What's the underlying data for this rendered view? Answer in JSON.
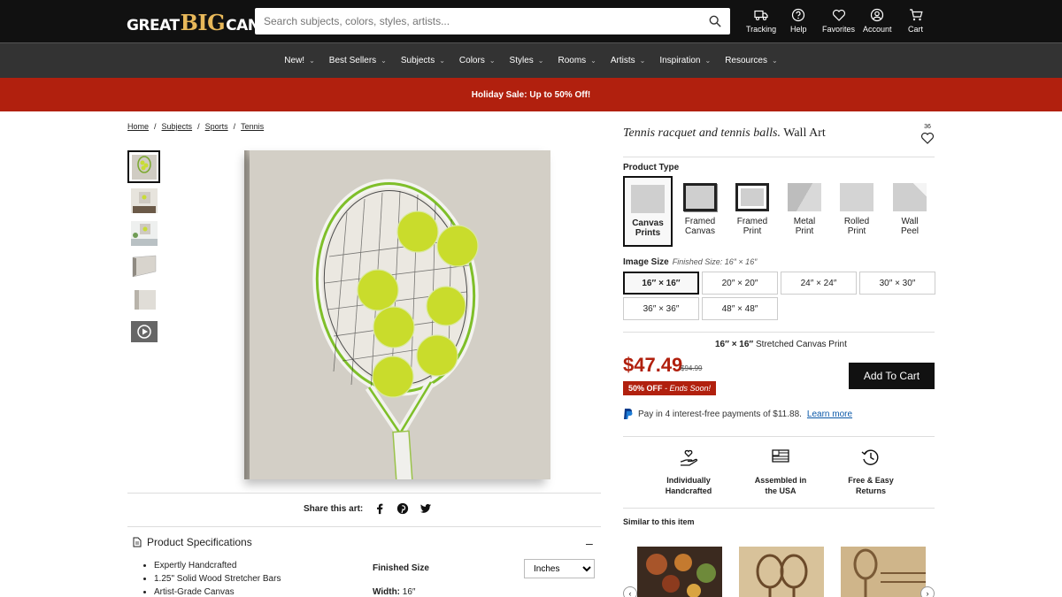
{
  "header": {
    "logo": {
      "part1": "GREAT",
      "part2": "BIG",
      "part3": "CANVAS."
    },
    "search_placeholder": "Search subjects, colors, styles, artists...",
    "nav": [
      {
        "label": "Tracking",
        "icon": "truck-icon"
      },
      {
        "label": "Help",
        "icon": "help-icon"
      },
      {
        "label": "Favorites",
        "icon": "heart-icon"
      },
      {
        "label": "Account",
        "icon": "account-icon"
      },
      {
        "label": "Cart",
        "icon": "cart-icon"
      }
    ]
  },
  "menu": [
    {
      "label": "New!"
    },
    {
      "label": "Best Sellers"
    },
    {
      "label": "Subjects"
    },
    {
      "label": "Colors"
    },
    {
      "label": "Styles"
    },
    {
      "label": "Rooms"
    },
    {
      "label": "Artists"
    },
    {
      "label": "Inspiration"
    },
    {
      "label": "Resources"
    }
  ],
  "promo": "Holiday Sale: Up to 50% Off!",
  "breadcrumb": [
    "Home",
    "Subjects",
    "Sports",
    "Tennis"
  ],
  "product": {
    "title_italic": "Tennis racquet and tennis balls.",
    "title_rest": "Wall Art",
    "favorites_count": "36",
    "product_type_label": "Product Type",
    "types": [
      {
        "line1": "Canvas",
        "line2": "Prints"
      },
      {
        "line1": "Framed",
        "line2": "Canvas"
      },
      {
        "line1": "Framed",
        "line2": "Print"
      },
      {
        "line1": "Metal",
        "line2": "Print"
      },
      {
        "line1": "Rolled",
        "line2": "Print"
      },
      {
        "line1": "Wall",
        "line2": "Peel"
      }
    ],
    "image_size_label": "Image Size",
    "finished_size": "Finished Size: 16″ × 16″",
    "sizes": [
      "16″ × 16″",
      "20″ × 20″",
      "24″ × 24″",
      "30″ × 30″",
      "36″ × 36″",
      "48″ × 48″"
    ],
    "stretched_size": "16″ × 16″",
    "stretched_text": "Stretched Canvas Print",
    "price": "$47.49",
    "old_price": "$94.99",
    "off_text": "50% OFF",
    "off_sub": " - Ends Soon!",
    "add_to_cart": "Add To Cart",
    "paypal_text": "Pay in 4 interest-free payments of $11.88.",
    "paypal_link": "Learn more",
    "features": [
      {
        "line1": "Individually",
        "line2": "Handcrafted"
      },
      {
        "line1": "Assembled in",
        "line2": "the USA"
      },
      {
        "line1": "Free & Easy",
        "line2": "Returns"
      }
    ],
    "similar_label": "Similar to this item"
  },
  "share": {
    "label": "Share this art:"
  },
  "specs": {
    "title": "Product Specifications",
    "items": [
      "Expertly Handcrafted",
      "1.25\" Solid Wood Stretcher Bars",
      "Artist-Grade Canvas"
    ],
    "finished_size_label": "Finished Size",
    "unit_selected": "Inches",
    "width_label": "Width:",
    "width_value": "16″"
  }
}
